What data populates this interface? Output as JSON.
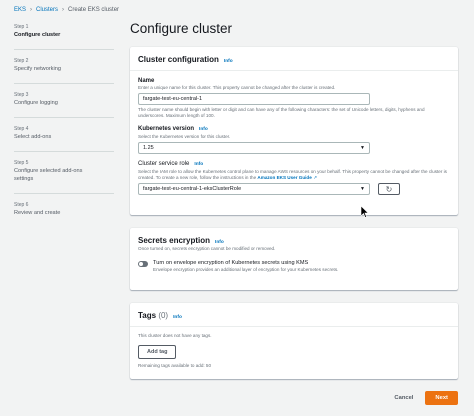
{
  "breadcrumb": [
    "EKS",
    "Clusters",
    "Create EKS cluster"
  ],
  "steps": [
    {
      "num": "Step 1",
      "label": "Configure cluster",
      "active": true
    },
    {
      "num": "Step 2",
      "label": "Specify networking",
      "active": false
    },
    {
      "num": "Step 3",
      "label": "Configure logging",
      "active": false
    },
    {
      "num": "Step 4",
      "label": "Select add-ons",
      "active": false
    },
    {
      "num": "Step 5",
      "label": "Configure selected add-ons settings",
      "active": false
    },
    {
      "num": "Step 6",
      "label": "Review and create",
      "active": false
    }
  ],
  "page_title": "Configure cluster",
  "cluster_config": {
    "title": "Cluster configuration",
    "info": "Info",
    "name_label": "Name",
    "name_desc": "Enter a unique name for this cluster. This property cannot be changed after the cluster is created.",
    "name_value": "fargate-test-eu-central-1",
    "name_hint": "The cluster name should begin with letter or digit and can have any of the following characters: the set of Unicode letters, digits, hyphens and underscores. Maximum length of 100.",
    "k8s_label": "Kubernetes version",
    "k8s_info": "Info",
    "k8s_desc": "Select the Kubernetes version for this cluster.",
    "k8s_value": "1.25",
    "role_label": "Cluster service role",
    "role_info": "Info",
    "role_desc": "Select the IAM role to allow the Kubernetes control plane to manage AWS resources on your behalf. This property cannot be changed after the cluster is created. To create a new role, follow the instructions in the",
    "role_link": "Amazon EKS User Guide",
    "role_value": "fargate-test-eu-central-1-eksClusterRole"
  },
  "secrets": {
    "title": "Secrets encryption",
    "info": "Info",
    "desc": "Once turned on, secrets encryption cannot be modified or removed.",
    "toggle_label": "Turn on envelope encryption of Kubernetes secrets using KMS",
    "toggle_desc": "Envelope encryption provides an additional layer of encryption for your Kubernetes secrets."
  },
  "tags": {
    "title": "Tags",
    "count": "(0)",
    "info": "Info",
    "empty": "This cluster does not have any tags.",
    "add_label": "Add tag",
    "remaining": "Remaining tags available to add: 50"
  },
  "footer": {
    "cancel": "Cancel",
    "next": "Next"
  },
  "colors": {
    "accent": "#ec7211",
    "link": "#0073bb"
  }
}
